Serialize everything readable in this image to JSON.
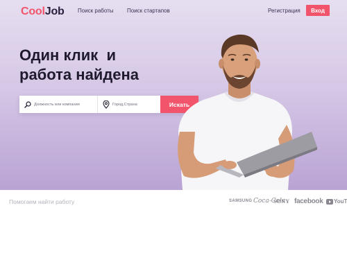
{
  "brand": {
    "part1": "Cool",
    "part2": "Job"
  },
  "nav": {
    "jobs": "Поиск работы",
    "startups": "Поиск стартапов"
  },
  "auth": {
    "register": "Регистрация",
    "login": "Вход"
  },
  "hero": {
    "line1": "Один клик  и",
    "line2": "работа найдена"
  },
  "search": {
    "job_placeholder": "Должность или компания",
    "location_placeholder": "Город,Страна",
    "button": "Искать"
  },
  "footer": {
    "tagline": "Помогаем найти работу",
    "partners": [
      "SAMSUNG",
      "Coca-Cola",
      "SONY",
      "facebook",
      "YouTube"
    ]
  },
  "colors": {
    "accent": "#f2546b",
    "dark": "#2a1f3d",
    "hero_top": "#e6def0",
    "hero_bottom": "#b9a3d4"
  }
}
